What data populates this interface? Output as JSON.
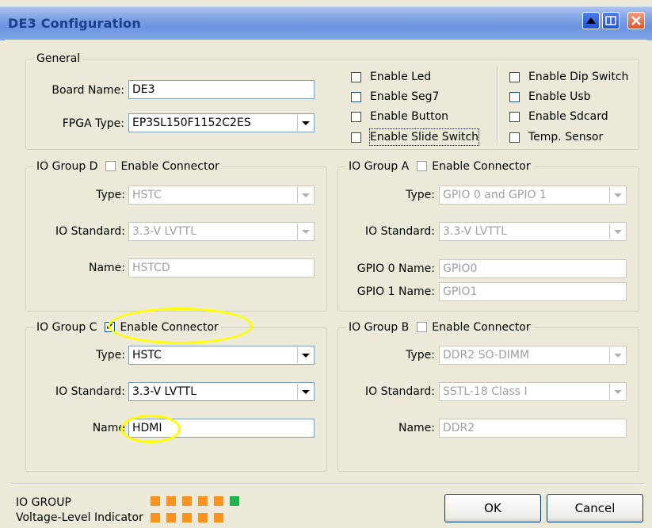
{
  "window": {
    "title": "DE3 Configuration"
  },
  "general": {
    "legend": "General",
    "board_name_label": "Board Name:",
    "board_name_value": "DE3",
    "fpga_type_label": "FPGA Type:",
    "fpga_type_value": "EP3SL150F1152C2ES",
    "options_col1": [
      {
        "label": "Enable Led",
        "checked": false
      },
      {
        "label": "Enable Seg7",
        "checked": false
      },
      {
        "label": "Enable Button",
        "checked": false
      },
      {
        "label": "Enable Slide Switch",
        "checked": false
      }
    ],
    "options_col2": [
      {
        "label": "Enable Dip Switch",
        "checked": false
      },
      {
        "label": "Enable Usb",
        "checked": false
      },
      {
        "label": "Enable Sdcard",
        "checked": false
      },
      {
        "label": "Temp. Sensor",
        "checked": false
      }
    ]
  },
  "io_group_d": {
    "legend": "IO Group D",
    "enable_label": "Enable Connector",
    "enabled": false,
    "type_label": "Type:",
    "type_value": "HSTC",
    "io_standard_label": "IO Standard:",
    "io_standard_value": "3.3-V LVTTL",
    "name_label": "Name:",
    "name_value": "HSTCD"
  },
  "io_group_a": {
    "legend": "IO Group A",
    "enable_label": "Enable Connector",
    "enabled": false,
    "type_label": "Type:",
    "type_value": "GPIO 0 and GPIO 1",
    "io_standard_label": "IO Standard:",
    "io_standard_value": "3.3-V LVTTL",
    "gpio0_label": "GPIO 0 Name:",
    "gpio0_value": "GPIO0",
    "gpio1_label": "GPIO 1 Name:",
    "gpio1_value": "GPIO1"
  },
  "io_group_c": {
    "legend": "IO Group C",
    "enable_label": "Enable Connector",
    "enabled": true,
    "type_label": "Type:",
    "type_value": "HSTC",
    "io_standard_label": "IO Standard:",
    "io_standard_value": "3.3-V LVTTL",
    "name_label": "Name",
    "name_value": "HDMI"
  },
  "io_group_b": {
    "legend": "IO Group B",
    "enable_label": "Enable Connector",
    "enabled": false,
    "type_label": "Type:",
    "type_value": "DDR2 SO-DIMM",
    "io_standard_label": "IO Standard:",
    "io_standard_value": "SSTL-18 Class I",
    "name_label": "Name:",
    "name_value": "DDR2"
  },
  "footer": {
    "indicator_label_line1": "IO GROUP",
    "indicator_label_line2": "Voltage-Level Indicator",
    "indicator_colors": {
      "orange": "#f7931e",
      "green": "#22b14c"
    },
    "ok_label": "OK",
    "cancel_label": "Cancel"
  },
  "colors": {
    "titlebar": "#7fa2e4",
    "highlight": "#ffff00",
    "window_bg": "#ece9d8"
  }
}
